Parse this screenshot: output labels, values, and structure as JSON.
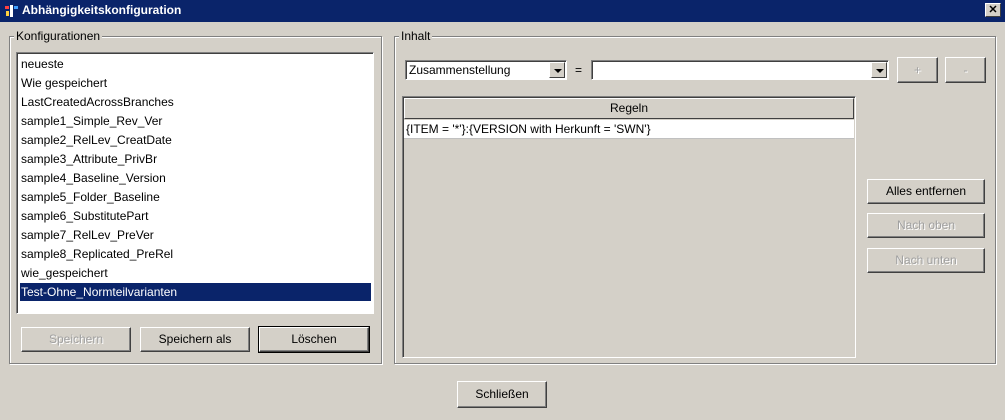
{
  "window": {
    "title": "Abhängigkeitskonfiguration",
    "close_symbol": "✕"
  },
  "configurations": {
    "group_label": "Konfigurationen",
    "items": [
      "neueste",
      "Wie gespeichert",
      "LastCreatedAcrossBranches",
      "sample1_Simple_Rev_Ver",
      "sample2_RelLev_CreatDate",
      "sample3_Attribute_PrivBr",
      "sample4_Baseline_Version",
      "sample5_Folder_Baseline",
      "sample6_SubstitutePart",
      "sample7_RelLev_PreVer",
      "sample8_Replicated_PreRel",
      "wie_gespeichert",
      "Test-Ohne_Normteilvarianten"
    ],
    "selected_index": 12,
    "buttons": {
      "save": "Speichern",
      "save_as": "Speichern als",
      "delete": "Löschen"
    }
  },
  "content": {
    "group_label": "Inhalt",
    "filter_type": "Zusammenstellung",
    "equals_sign": "=",
    "filter_value": "",
    "add_label": "+",
    "remove_label": "-",
    "table": {
      "header": "Regeln",
      "rows": [
        "{ITEM = '*'}:{VERSION with Herkunft = 'SWN'}"
      ]
    },
    "buttons": {
      "remove_all": "Alles entfernen",
      "move_up": "Nach oben",
      "move_down": "Nach unten"
    }
  },
  "footer": {
    "close": "Schließen"
  },
  "colors": {
    "titlebar": "#0a246a",
    "window_bg": "#d4d0c8",
    "selection": "#0a246a"
  }
}
